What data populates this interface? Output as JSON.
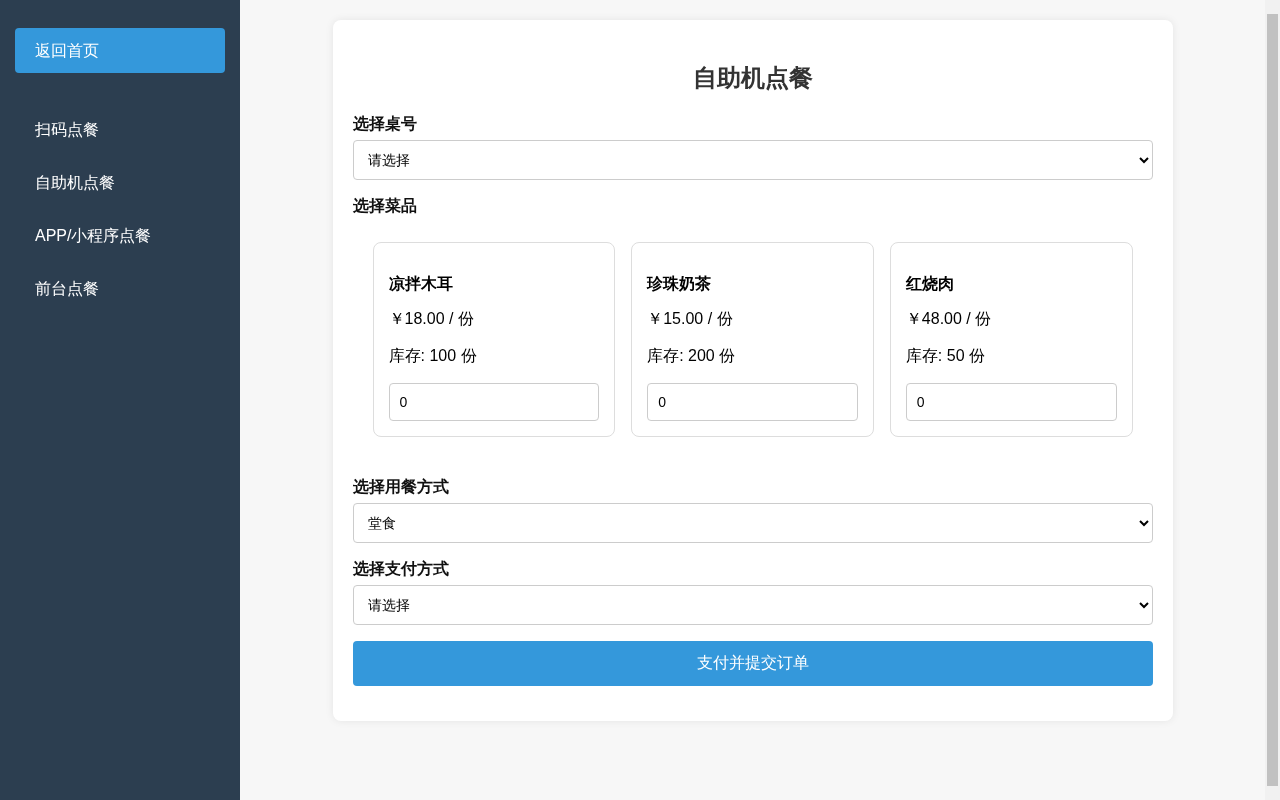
{
  "sidebar": {
    "items": [
      {
        "label": "返回首页",
        "kind": "button"
      },
      {
        "label": "扫码点餐",
        "kind": "link"
      },
      {
        "label": "自助机点餐",
        "kind": "link"
      },
      {
        "label": "APP/小程序点餐",
        "kind": "link"
      },
      {
        "label": "前台点餐",
        "kind": "link"
      }
    ]
  },
  "form": {
    "title": "自助机点餐",
    "table": {
      "label": "选择桌号",
      "value": "请选择"
    },
    "dishes_label": "选择菜品",
    "dishes": [
      {
        "name": "凉拌木耳",
        "price": "￥18.00 / 份",
        "stock": "库存: 100 份",
        "quantity": "0"
      },
      {
        "name": "珍珠奶茶",
        "price": "￥15.00 / 份",
        "stock": "库存: 200 份",
        "quantity": "0"
      },
      {
        "name": "红烧肉",
        "price": "￥48.00 / 份",
        "stock": "库存: 50 份",
        "quantity": "0"
      }
    ],
    "dining": {
      "label": "选择用餐方式",
      "value": "堂食"
    },
    "payment": {
      "label": "选择支付方式",
      "value": "请选择"
    },
    "submit": "支付并提交订单"
  }
}
